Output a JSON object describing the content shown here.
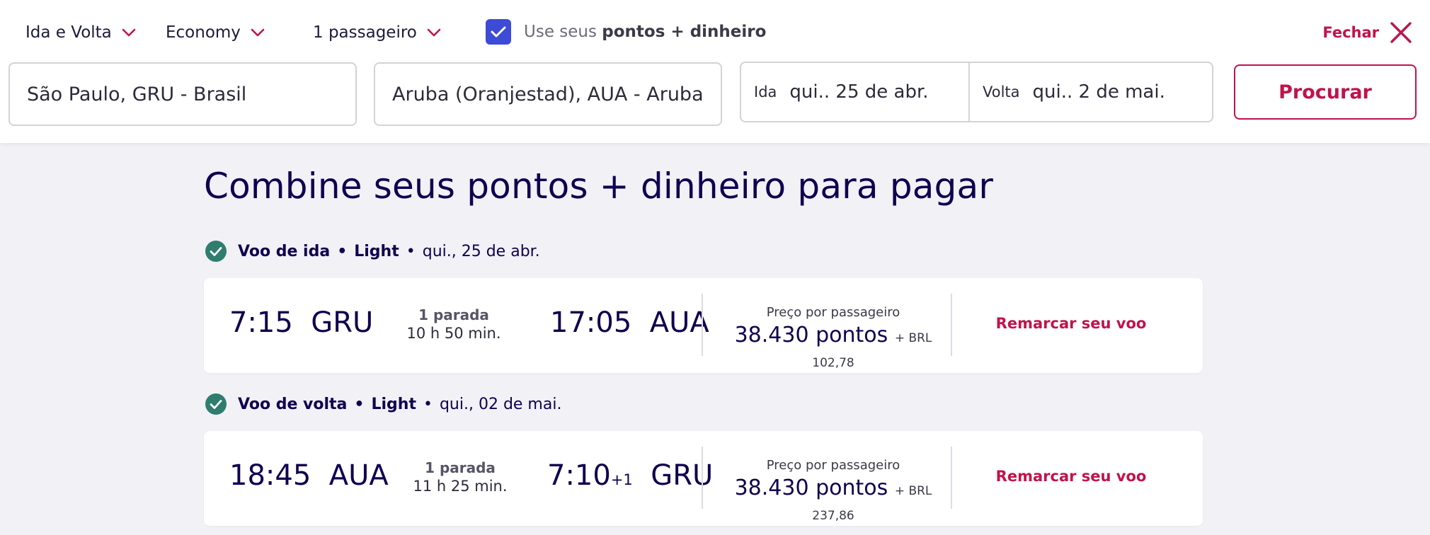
{
  "search": {
    "trip_type": "Ida e Volta",
    "cabin": "Economy",
    "passengers": "1 passageiro",
    "points_checkbox": {
      "checked": true,
      "label_prefix": "Use seus",
      "label_bold": "pontos + dinheiro"
    },
    "close_label": "Fechar",
    "origin": "São Paulo, GRU - Brasil",
    "destination": "Aruba (Oranjestad), AUA - Aruba",
    "depart_label": "Ida",
    "depart_value": "qui.. 25 de abr.",
    "return_label": "Volta",
    "return_value": "qui.. 2 de mai.",
    "search_button": "Procurar"
  },
  "main": {
    "title": "Combine seus pontos + dinheiro para pagar",
    "segments": [
      {
        "label": "Voo de ida",
        "fare": "Light",
        "date": "qui., 25 de abr.",
        "depart_time": "7:15",
        "depart_airport": "GRU",
        "stops": "1 parada",
        "duration": "10 h 50 min.",
        "arrive_time": "17:05",
        "arrive_day_offset": "",
        "arrive_airport": "AUA",
        "price_label": "Preço por passageiro",
        "points": "38.430 pontos",
        "cash": "+ BRL 102,78",
        "action": "Remarcar seu voo"
      },
      {
        "label": "Voo de volta",
        "fare": "Light",
        "date": "qui., 02 de mai.",
        "depart_time": "18:45",
        "depart_airport": "AUA",
        "stops": "1 parada",
        "duration": "11 h 25 min.",
        "arrive_time": "7:10",
        "arrive_day_offset": "+1",
        "arrive_airport": "GRU",
        "price_label": "Preço por passageiro",
        "points": "38.430 pontos",
        "cash": "+ BRL 237,86",
        "action": "Remarcar seu voo"
      }
    ]
  },
  "colors": {
    "brand": "#c0134c",
    "navy": "#10004f",
    "checkbox": "#3d4bd6",
    "success": "#2f7d6d",
    "background": "#f1f1f6"
  }
}
